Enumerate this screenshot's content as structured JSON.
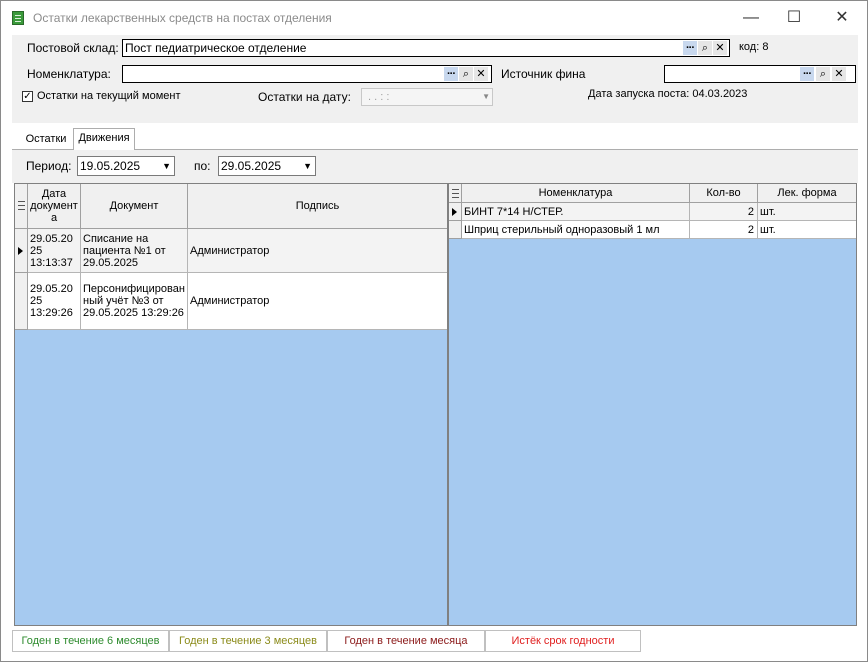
{
  "window": {
    "title": "Остатки лекарственных средств на постах отделения",
    "min_glyph": "—",
    "max_glyph": "☐",
    "close_glyph": "✕"
  },
  "filters": {
    "post_label": "Постовой склад:",
    "post_value": "Пост педиатрическое отделение",
    "code_text": "код: 8",
    "nomenclature_label": "Номенклатура:",
    "nomenclature_value": "",
    "source_label": "Источник фина",
    "source_value": "",
    "current_checkbox_label": "Остатки на текущий момент",
    "current_checked": true,
    "date_label": "Остатки на дату:",
    "date_value": ". .   : :",
    "launch_date_text": "Дата запуска поста: 04.03.2023"
  },
  "tabs": [
    {
      "label": "Остатки",
      "active": false
    },
    {
      "label": "Движения",
      "active": true
    }
  ],
  "period": {
    "label": "Период:",
    "from": "19.05.2025",
    "to_label": "по:",
    "to": "29.05.2025"
  },
  "documents_grid": {
    "headers": [
      "Дата документ а",
      "Документ",
      "Подпись"
    ],
    "rows": [
      {
        "date": "29.05.20 25 13:13:37",
        "document": "Списание на пациента №1 от 29.05.2025",
        "signature": "Администратор",
        "current": true
      },
      {
        "date": "29.05.20 25 13:29:26",
        "document": "Персонифицирован ный учёт №3 от 29.05.2025 13:29:26",
        "signature": "Администратор",
        "current": false
      }
    ]
  },
  "items_grid": {
    "headers": [
      "Номенклатура",
      "Кол-во",
      "Лек. форма"
    ],
    "rows": [
      {
        "name": "БИНТ 7*14 Н/СТЕР.",
        "qty": "2",
        "form": "шт.",
        "current": true
      },
      {
        "name": "Шприц стерильный одноразовый 1 мл",
        "qty": "2",
        "form": "шт.",
        "current": false
      }
    ]
  },
  "legend": [
    {
      "label": "Годен в течение 6 месяцев",
      "color": "#2e8b2e"
    },
    {
      "label": "Годен в течение 3 месяцев",
      "color": "#8b8b1a"
    },
    {
      "label": "Годен в течение месяца",
      "color": "#8b1a1a"
    },
    {
      "label": "Истёк срок годности",
      "color": "#e02020"
    }
  ],
  "colors": {
    "grid_empty": "#a6caf0",
    "panel": "#f0f0f0"
  }
}
